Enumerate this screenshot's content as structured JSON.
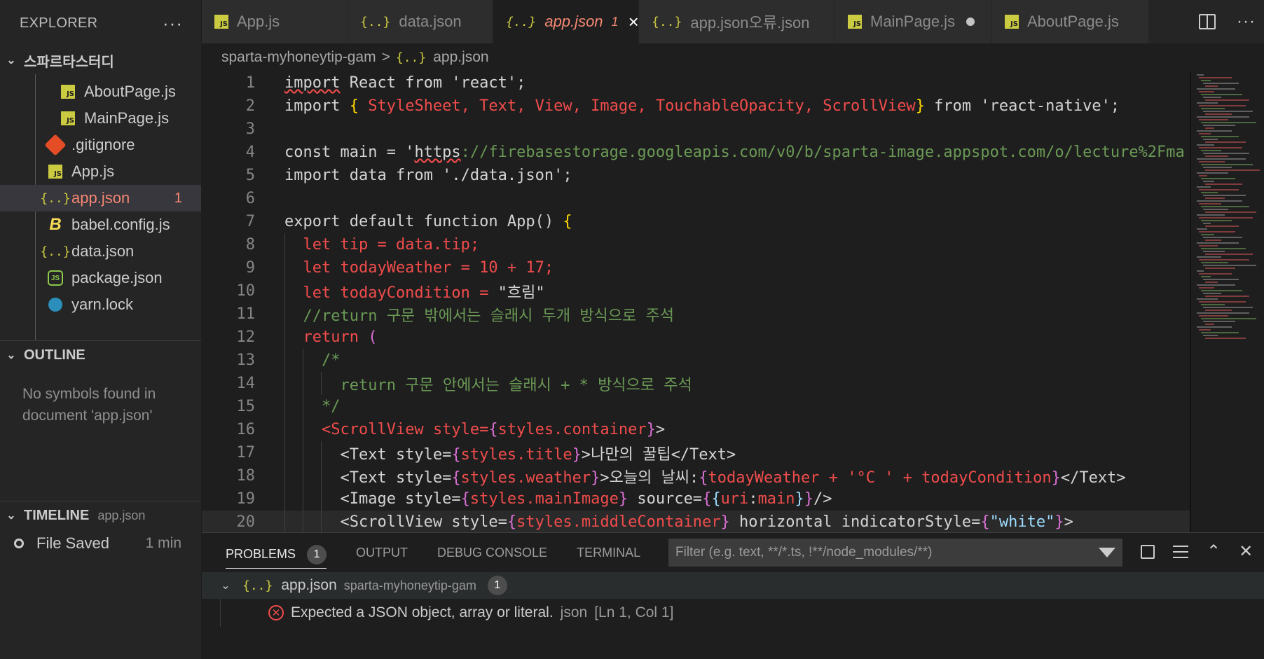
{
  "sidebar": {
    "title": "EXPLORER",
    "more": "···",
    "root_folder": "스파르타스터디",
    "files": [
      {
        "name": "AboutPage.js",
        "icon": "js-icon"
      },
      {
        "name": "MainPage.js",
        "icon": "js-icon"
      },
      {
        "name": ".gitignore",
        "icon": "git-icon"
      },
      {
        "name": "App.js",
        "icon": "js-icon"
      },
      {
        "name": "app.json",
        "icon": "json-icon",
        "badge": "1"
      },
      {
        "name": "babel.config.js",
        "icon": "babel-icon"
      },
      {
        "name": "data.json",
        "icon": "json-icon"
      },
      {
        "name": "package.json",
        "icon": "nodejs-icon"
      },
      {
        "name": "yarn.lock",
        "icon": "yarn-icon"
      }
    ],
    "outline_title": "OUTLINE",
    "outline_message": "No symbols found in document 'app.json'",
    "timeline_title": "TIMELINE",
    "timeline_file": "app.json",
    "timeline_item": "File Saved",
    "timeline_time": "1 min"
  },
  "tabs": [
    {
      "label": "App.js",
      "icon": "js-icon"
    },
    {
      "label": "data.json",
      "icon": "json-icon"
    },
    {
      "label": "app.json",
      "icon": "json-icon",
      "badge": "1",
      "close": "×"
    },
    {
      "label": "app.json오류.json",
      "icon": "json-icon"
    },
    {
      "label": "MainPage.js",
      "icon": "js-icon"
    },
    {
      "label": "AboutPage.js",
      "icon": "js-icon"
    }
  ],
  "breadcrumb": {
    "folder": "sparta-myhoneytip-gam",
    "sep": ">",
    "file": "app.json"
  },
  "json_glyph": "{..}",
  "js_glyph": "JS",
  "editor": {
    "line_numbers": [
      "1",
      "2",
      "3",
      "4",
      "5",
      "6",
      "7",
      "8",
      "9",
      "10",
      "11",
      "12",
      "13",
      "14",
      "15",
      "16",
      "17",
      "18",
      "19",
      "20"
    ]
  },
  "panel": {
    "tabs": [
      "PROBLEMS",
      "OUTPUT",
      "DEBUG CONSOLE",
      "TERMINAL"
    ],
    "problems_count": "1",
    "filter_placeholder": "Filter (e.g. text, **/*.ts, !**/node_modules/**)",
    "group_file": "app.json",
    "group_path": "sparta-myhoneytip-gam",
    "group_count": "1",
    "error_message": "Expected a JSON object, array or literal.",
    "error_source": "json",
    "error_location": "[Ln 1, Col 1]"
  },
  "colors": {
    "error": "#f48771",
    "editor_bg": "#1e1e1e",
    "sidebar_bg": "#252526"
  }
}
